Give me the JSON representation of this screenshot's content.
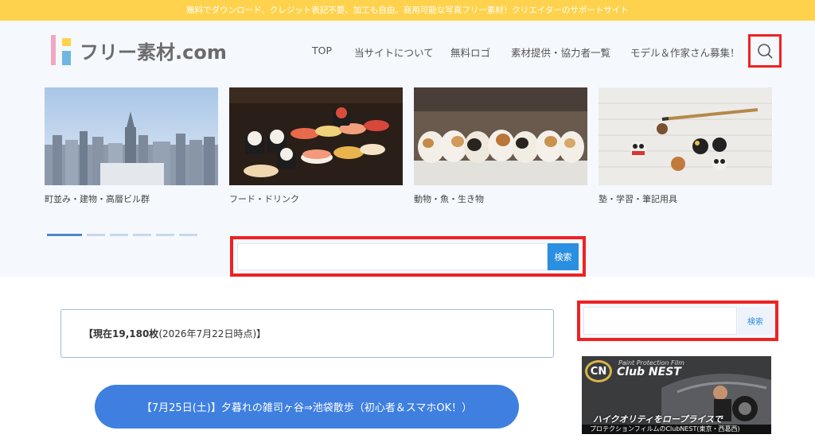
{
  "topbar": {
    "text": "無料でダウンロード、クレジット表記不要、加工も自由。商用可能な写真フリー素材！クリエイターのサポートサイト"
  },
  "logo": {
    "text": "フリー素材.com"
  },
  "nav": {
    "items": [
      "TOP",
      "当サイトについて",
      "無料ロゴ",
      "素材提供・協力者一覧",
      "モデル＆作家さん募集！"
    ]
  },
  "header_search": {
    "icon": "search-icon"
  },
  "carousel": {
    "cards": [
      {
        "caption": "町並み・建物・高層ビル群"
      },
      {
        "caption": "フード・ドリンク"
      },
      {
        "caption": "動物・魚・生き物"
      },
      {
        "caption": "塾・学習・筆記用具"
      }
    ],
    "active_slide": 1,
    "slide_count": 6
  },
  "hero_search": {
    "value": "",
    "button": "検索"
  },
  "count": {
    "bold": "【現在19,180枚",
    "rest": "(2026年7月22日時点)】"
  },
  "event": {
    "label": "【7月25日(土)】夕暮れの雑司ヶ谷⇒池袋散歩（初心者＆スマホOK！）"
  },
  "sidebar_search": {
    "value": "",
    "button": "検索"
  },
  "ad": {
    "logo_letters": "CN",
    "brand_small": "Paint Protection Film",
    "brand": "Club NEST",
    "tagline": "ハイクオリティをロープライスで",
    "subtitle": "プロテクションフィルムのClubNEST(東京・西葛西)"
  },
  "colors": {
    "topbar": "#ffd24d",
    "accent": "#2a8fe0",
    "highlight": "#ee2222",
    "pill": "#3e7fe0"
  }
}
